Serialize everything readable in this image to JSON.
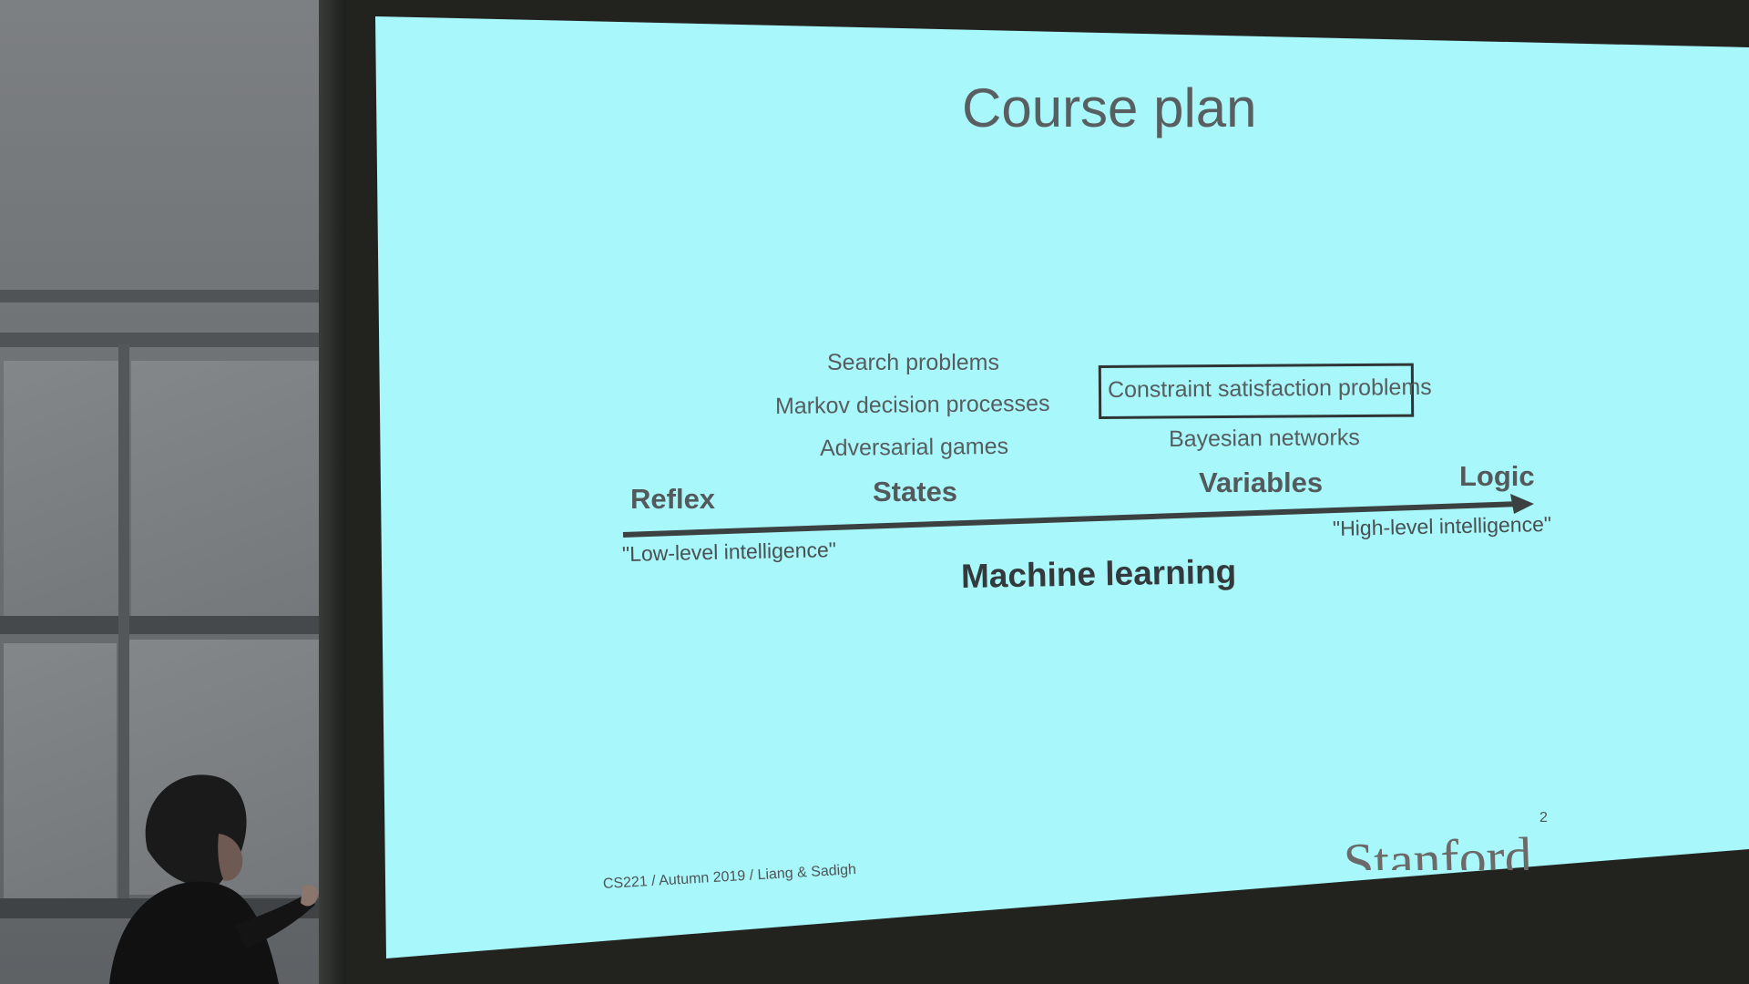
{
  "slide": {
    "title": "Course plan",
    "states_topics": [
      "Search problems",
      "Markov decision processes",
      "Adversarial games"
    ],
    "variables_topics": {
      "highlighted": "Constraint satisfaction problems",
      "other": "Bayesian networks"
    },
    "axis": {
      "labels": [
        "Reflex",
        "States",
        "Variables",
        "Logic"
      ],
      "left_quote": "\"Low-level intelligence\"",
      "right_quote": "\"High-level intelligence\""
    },
    "center_label": "Machine learning",
    "footer": "CS221 / Autumn 2019 / Liang & Sadigh",
    "page_number": "2",
    "logo_text": "Stanford"
  },
  "colors": {
    "slide_background": "#a8f7fb",
    "slide_text": "#575d5e",
    "arrow": "#3b4141",
    "room_dark": "#22231f"
  }
}
